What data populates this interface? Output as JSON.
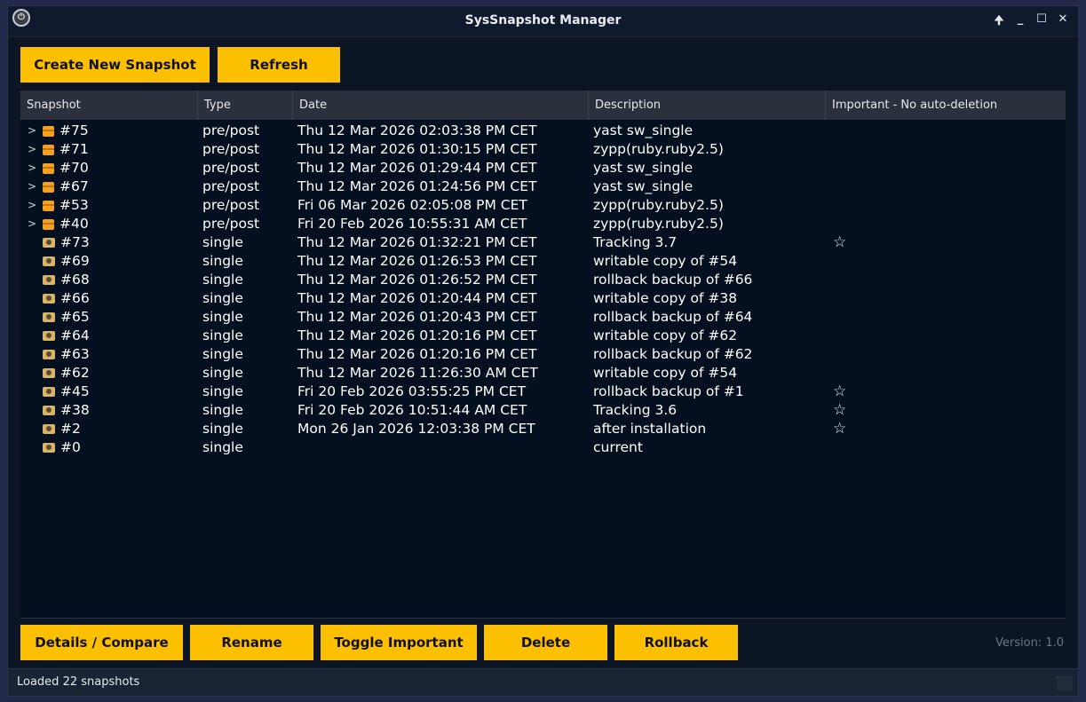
{
  "window": {
    "title": "SysSnapshot Manager",
    "controls": {
      "keep_above": "🠉",
      "minimize": "_",
      "maximize": "☐",
      "close": "✕"
    }
  },
  "toolbar": {
    "create_label": "Create New Snapshot",
    "refresh_label": "Refresh"
  },
  "table": {
    "columns": [
      "Snapshot",
      "Type",
      "Date",
      "Description",
      "Important - No auto-deletion"
    ],
    "rows": [
      {
        "id": "#75",
        "type": "pre/post",
        "date": "Thu 12 Mar 2026 02:03:38 PM CET",
        "description": "yast sw_single",
        "important": "",
        "expandable": true
      },
      {
        "id": "#71",
        "type": "pre/post",
        "date": "Thu 12 Mar 2026 01:30:15 PM CET",
        "description": "zypp(ruby.ruby2.5)",
        "important": "",
        "expandable": true
      },
      {
        "id": "#70",
        "type": "pre/post",
        "date": "Thu 12 Mar 2026 01:29:44 PM CET",
        "description": "yast sw_single",
        "important": "",
        "expandable": true
      },
      {
        "id": "#67",
        "type": "pre/post",
        "date": "Thu 12 Mar 2026 01:24:56 PM CET",
        "description": "yast sw_single",
        "important": "",
        "expandable": true
      },
      {
        "id": "#53",
        "type": "pre/post",
        "date": "Fri 06 Mar 2026 02:05:08 PM CET",
        "description": "zypp(ruby.ruby2.5)",
        "important": "",
        "expandable": true
      },
      {
        "id": "#40",
        "type": "pre/post",
        "date": "Fri 20 Feb 2026 10:55:31 AM CET",
        "description": "zypp(ruby.ruby2.5)",
        "important": "",
        "expandable": true
      },
      {
        "id": "#73",
        "type": "single",
        "date": "Thu 12 Mar 2026 01:32:21 PM CET",
        "description": "Tracking 3.7",
        "important": "☆",
        "expandable": false
      },
      {
        "id": "#69",
        "type": "single",
        "date": "Thu 12 Mar 2026 01:26:53 PM CET",
        "description": "writable copy of #54",
        "important": "",
        "expandable": false
      },
      {
        "id": "#68",
        "type": "single",
        "date": "Thu 12 Mar 2026 01:26:52 PM CET",
        "description": "rollback backup of #66",
        "important": "",
        "expandable": false
      },
      {
        "id": "#66",
        "type": "single",
        "date": "Thu 12 Mar 2026 01:20:44 PM CET",
        "description": "writable copy of #38",
        "important": "",
        "expandable": false
      },
      {
        "id": "#65",
        "type": "single",
        "date": "Thu 12 Mar 2026 01:20:43 PM CET",
        "description": "rollback backup of #64",
        "important": "",
        "expandable": false
      },
      {
        "id": "#64",
        "type": "single",
        "date": "Thu 12 Mar 2026 01:20:16 PM CET",
        "description": "writable copy of #62",
        "important": "",
        "expandable": false
      },
      {
        "id": "#63",
        "type": "single",
        "date": "Thu 12 Mar 2026 01:20:16 PM CET",
        "description": "rollback backup of #62",
        "important": "",
        "expandable": false
      },
      {
        "id": "#62",
        "type": "single",
        "date": "Thu 12 Mar 2026 11:26:30 AM CET",
        "description": "writable copy of #54",
        "important": "",
        "expandable": false
      },
      {
        "id": "#45",
        "type": "single",
        "date": "Fri 20 Feb 2026 03:55:25 PM CET",
        "description": "rollback backup of #1",
        "important": "☆",
        "expandable": false
      },
      {
        "id": "#38",
        "type": "single",
        "date": "Fri 20 Feb 2026 10:51:44 AM CET",
        "description": "Tracking 3.6",
        "important": "☆",
        "expandable": false
      },
      {
        "id": "#2",
        "type": "single",
        "date": "Mon 26 Jan 2026 12:03:38 PM CET",
        "description": "after installation",
        "important": "☆",
        "expandable": false
      },
      {
        "id": "#0",
        "type": "single",
        "date": "",
        "description": "current",
        "important": "",
        "expandable": false
      }
    ]
  },
  "actions": {
    "details_label": "Details / Compare",
    "rename_label": "Rename",
    "toggle_label": "Toggle Important",
    "delete_label": "Delete",
    "rollback_label": "Rollback"
  },
  "version": "Version: 1.0",
  "status": "Loaded 22 snapshots",
  "colors": {
    "accent": "#fdc000",
    "background": "#04101f",
    "header": "#2b313c"
  }
}
